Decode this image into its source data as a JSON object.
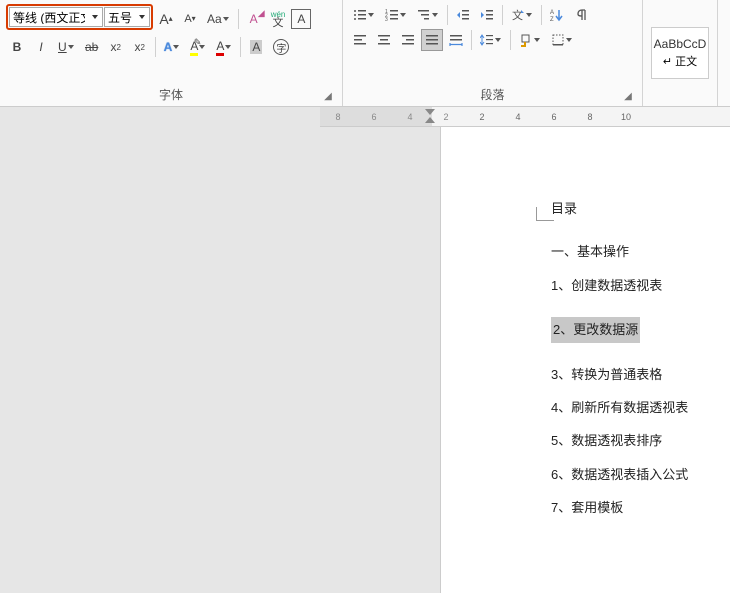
{
  "font": {
    "name": "等线 (西文正文)",
    "size": "五号",
    "grow_icon": "A",
    "shrink_icon": "A",
    "case": "Aa",
    "phonetic_top": "wén",
    "phonetic_bottom": "文",
    "charborder": "A",
    "bold": "B",
    "italic": "I",
    "underline": "U",
    "strike": "ab",
    "sub": "x₂",
    "sup": "x²",
    "fx_a": "A",
    "highlight_a": "A",
    "color_a": "A",
    "shade_a": "A",
    "group_label": "字体"
  },
  "para": {
    "group_label": "段落"
  },
  "styles": {
    "sample": "AaBbCcD",
    "name": "↵ 正文"
  },
  "ruler": {
    "left": [
      "8",
      "6",
      "4",
      "2"
    ],
    "right": [
      "2",
      "4",
      "6",
      "8",
      "10"
    ]
  },
  "doc": {
    "title": "目录",
    "l1": "一、基本操作",
    "l2": "1、创建数据透视表",
    "l3": "2、更改数据源",
    "l4": "3、转换为普通表格",
    "l5": "4、刷新所有数据透视表",
    "l6": "5、数据透视表排序",
    "l7": "6、数据透视表插入公式",
    "l8": "7、套用模板"
  }
}
